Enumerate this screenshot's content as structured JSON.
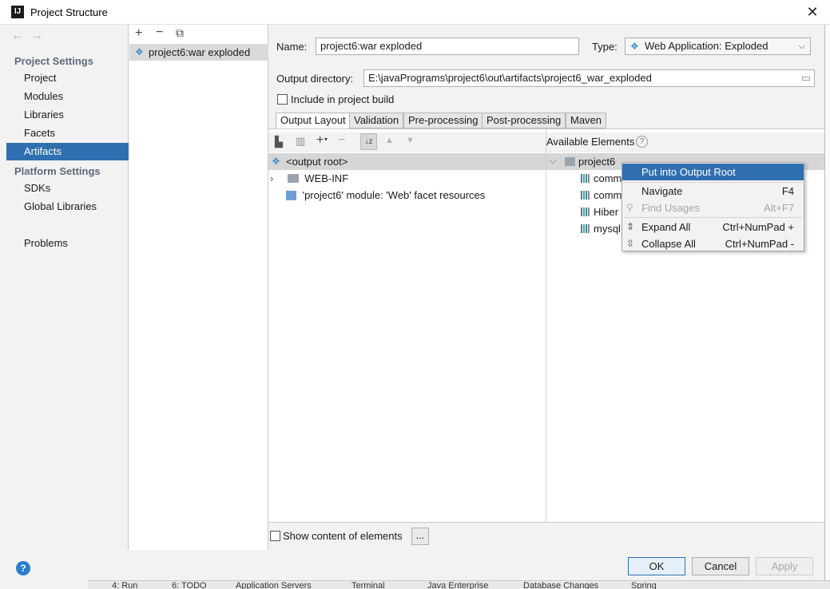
{
  "window": {
    "title": "Project Structure",
    "icon_text": "IJ"
  },
  "nav": {
    "project_settings_header": "Project Settings",
    "platform_settings_header": "Platform Settings",
    "items": {
      "project": "Project",
      "modules": "Modules",
      "libraries": "Libraries",
      "facets": "Facets",
      "artifacts": "Artifacts",
      "sdks": "SDKs",
      "global_libraries": "Global Libraries",
      "problems": "Problems"
    }
  },
  "artifacts_list": {
    "items": [
      "project6:war exploded"
    ]
  },
  "config": {
    "name_label": "Name:",
    "name_value": "project6:war exploded",
    "type_label": "Type:",
    "type_value": "Web Application: Exploded",
    "output_dir_label": "Output directory:",
    "output_dir_value": "E:\\javaPrograms\\project6\\out\\artifacts\\project6_war_exploded",
    "include_build_label": "Include in project build",
    "tabs": [
      "Output Layout",
      "Validation",
      "Pre-processing",
      "Post-processing",
      "Maven"
    ]
  },
  "output_tree": {
    "root": "<output root>",
    "children": [
      "WEB-INF",
      "'project6' module: 'Web' facet resources"
    ]
  },
  "available": {
    "header": "Available Elements",
    "project": "project6",
    "libs": [
      "comm",
      "comm",
      "Hiber",
      "mysql"
    ]
  },
  "context_menu": {
    "items": [
      {
        "label": "Put into Output Root",
        "shortcut": ""
      },
      {
        "label": "Navigate",
        "shortcut": "F4"
      },
      {
        "label": "Find Usages",
        "shortcut": "Alt+F7"
      },
      {
        "label": "Expand All",
        "shortcut": "Ctrl+NumPad +"
      },
      {
        "label": "Collapse All",
        "shortcut": "Ctrl+NumPad -"
      }
    ]
  },
  "bottom": {
    "show_content_label": "Show content of elements",
    "ellipsis": "...",
    "ok": "OK",
    "cancel": "Cancel",
    "apply": "Apply"
  },
  "ide_tool_tabs": [
    "4: Run",
    "6: TODO",
    "Application Servers",
    "Terminal",
    "Java Enterprise",
    "Database Changes",
    "Spring"
  ]
}
